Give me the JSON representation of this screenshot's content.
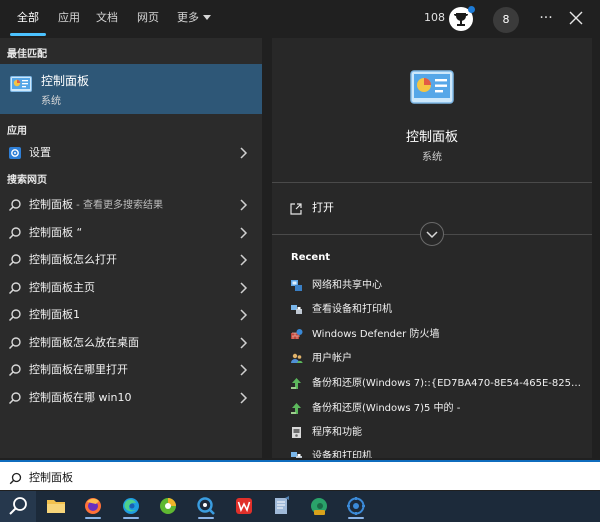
{
  "tabs": [
    {
      "label": "全部",
      "active": true
    },
    {
      "label": "应用"
    },
    {
      "label": "文档"
    },
    {
      "label": "网页"
    },
    {
      "label": "更多"
    }
  ],
  "header": {
    "points": "108",
    "avatar_initial": "8",
    "more_label": "···",
    "reward_icon": "rewards-trophy-icon",
    "close_icon": "close-icon"
  },
  "left": {
    "best_match_heading": "最佳匹配",
    "best_match": {
      "title": "控制面板",
      "subtitle": "系统",
      "icon": "control-panel-icon"
    },
    "apps_heading": "应用",
    "apps": [
      {
        "label": "设置",
        "icon": "gear-icon"
      }
    ],
    "web_heading": "搜索网页",
    "web_results": [
      {
        "label": "控制面板",
        "suffix": " - 查看更多搜索结果"
      },
      {
        "label": "控制面板 “",
        "suffix": ""
      },
      {
        "label": "控制面板怎么打开",
        "suffix": ""
      },
      {
        "label": "控制面板主页",
        "suffix": ""
      },
      {
        "label": "控制面板1",
        "suffix": ""
      },
      {
        "label": "控制面板怎么放在桌面",
        "suffix": ""
      },
      {
        "label": "控制面板在哪里打开",
        "suffix": ""
      },
      {
        "label": "控制面板在哪 win10",
        "suffix": ""
      }
    ]
  },
  "right": {
    "title": "控制面板",
    "subtitle": "系统",
    "open_label": "打开",
    "recent_heading": "Recent",
    "recent": [
      {
        "label": "网络和共享中心",
        "icon": "network-icon"
      },
      {
        "label": "查看设备和打印机",
        "icon": "devices-printers-icon"
      },
      {
        "label": "Windows Defender 防火墙",
        "icon": "firewall-icon"
      },
      {
        "label": "用户帐户",
        "icon": "user-accounts-icon"
      },
      {
        "label": "备份和还原(Windows 7)::{ED7BA470-8E54-465E-825C...",
        "icon": "backup-restore-icon"
      },
      {
        "label": "备份和还原(Windows 7)5 中的 -",
        "icon": "backup-restore-icon"
      },
      {
        "label": "程序和功能",
        "icon": "programs-features-icon"
      },
      {
        "label": "设备和打印机",
        "icon": "devices-printers-icon"
      }
    ]
  },
  "search": {
    "value": "控制面板",
    "icon": "search-icon"
  },
  "taskbar": {
    "apps": [
      {
        "name": "file-explorer-icon",
        "color": "#f2c14e"
      },
      {
        "name": "firefox-icon",
        "color": "#ff7139"
      },
      {
        "name": "edge-icon",
        "color": "#1e9de2"
      },
      {
        "name": "green-app-icon",
        "color": "#5fb832"
      },
      {
        "name": "blue-app-icon",
        "color": "#3a9de0"
      },
      {
        "name": "wps-icon",
        "color": "#e0302a"
      },
      {
        "name": "notepad-icon",
        "color": "#9fb9d8"
      },
      {
        "name": "edge-dev-icon",
        "color": "#2aa36a"
      },
      {
        "name": "network-settings-icon",
        "color": "#3b8ad8"
      }
    ]
  },
  "colors": {
    "accent": "#4cc2ff",
    "selected_row": "#2e5777",
    "left_pane": "#2b2b2b",
    "right_pane": "#282828",
    "taskbar": "#1c2a3a"
  }
}
